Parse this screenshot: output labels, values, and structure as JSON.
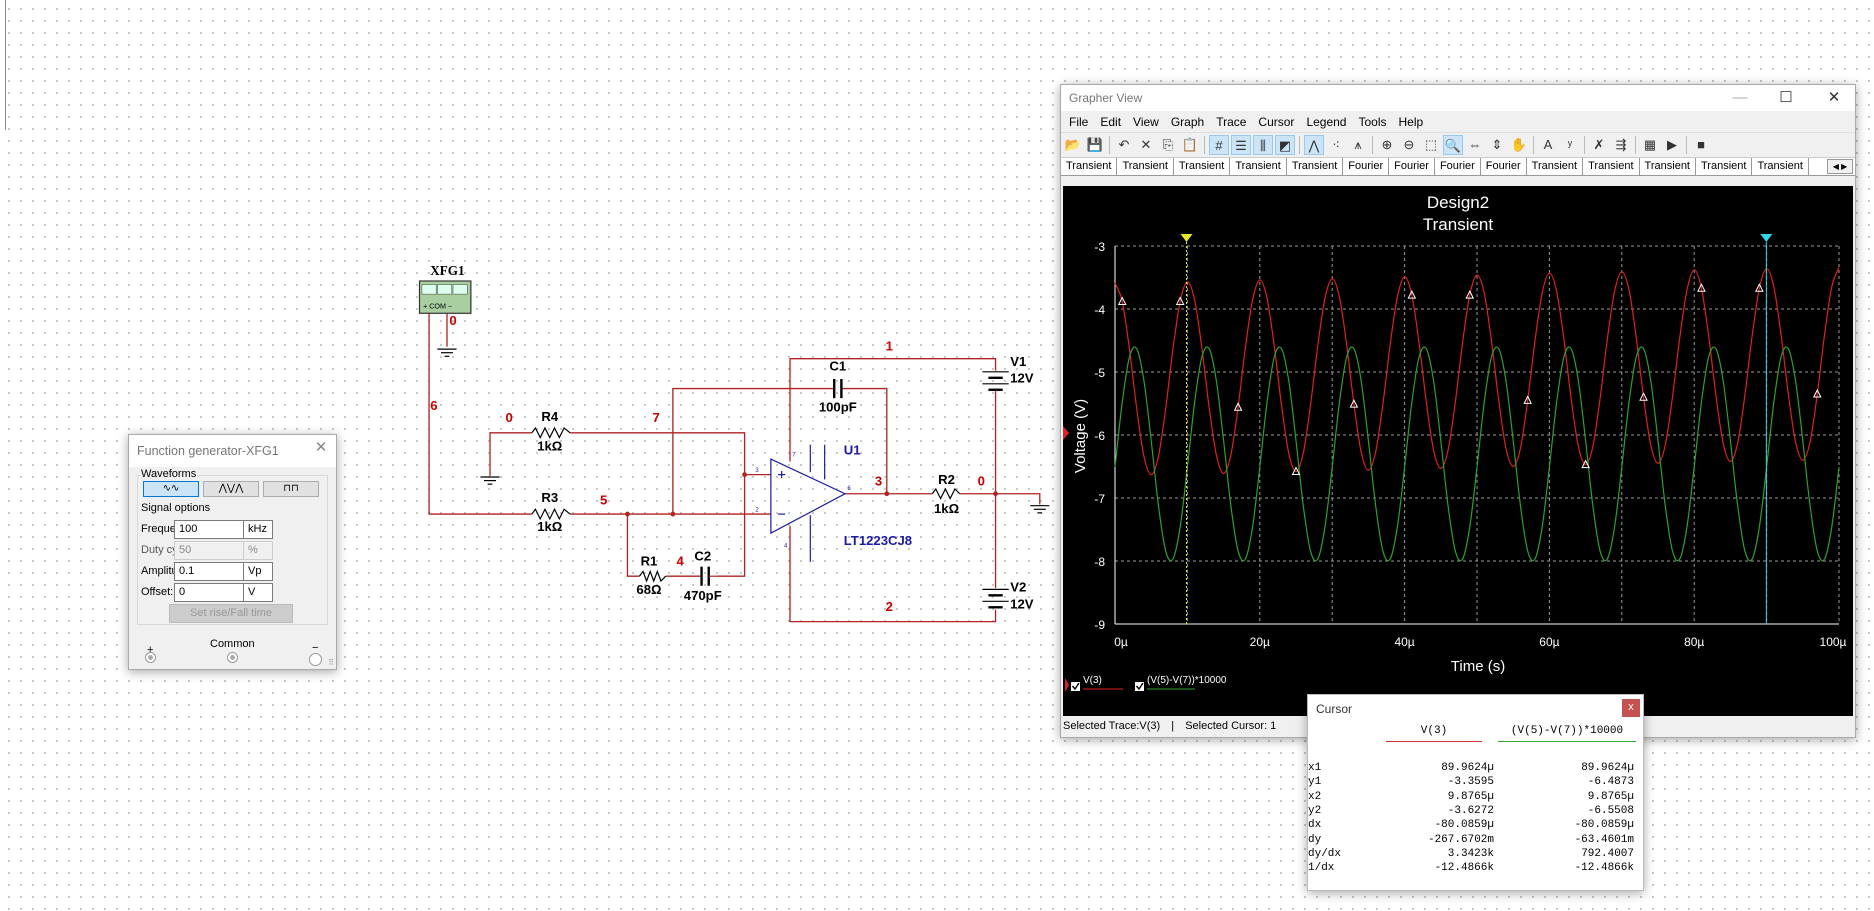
{
  "schematic": {
    "generator_ref": "XFG1",
    "generator_terminals": "+ COM −",
    "net_labels": {
      "n0a": "0",
      "n0b": "0",
      "n0c": "0",
      "n1": "1",
      "n2": "2",
      "n3": "3",
      "n4": "4",
      "n5": "5",
      "n6": "6",
      "n7": "7"
    },
    "components": {
      "R1": {
        "ref": "R1",
        "value": "68Ω"
      },
      "R2": {
        "ref": "R2",
        "value": "1kΩ"
      },
      "R3": {
        "ref": "R3",
        "value": "1kΩ"
      },
      "R4": {
        "ref": "R4",
        "value": "1kΩ"
      },
      "C1": {
        "ref": "C1",
        "value": "100pF"
      },
      "C2": {
        "ref": "C2",
        "value": "470pF"
      },
      "V1": {
        "ref": "V1",
        "value": "12V"
      },
      "V2": {
        "ref": "V2",
        "value": "12V"
      },
      "U1": {
        "ref": "U1",
        "part": "LT1223CJ8"
      }
    },
    "pin_numbers": {
      "plus": "3",
      "minus": "2",
      "out": "6",
      "top": "7",
      "bottom": "4"
    },
    "wire_color": "#b22222",
    "net_label_color": "#cc0000",
    "part_color": "#1a1aa6"
  },
  "function_generator": {
    "title": "Function generator-XFG1",
    "waveforms_label": "Waveforms",
    "waveforms": [
      "sine",
      "triangle",
      "square"
    ],
    "selected_waveform": "sine",
    "signal_options_label": "Signal options",
    "fields": [
      {
        "label": "Frequency:",
        "value": "100",
        "unit": "kHz",
        "enabled": true
      },
      {
        "label": "Duty cycle:",
        "value": "50",
        "unit": "%",
        "enabled": false
      },
      {
        "label": "Amplitude:",
        "value": "0.1",
        "unit": "Vp",
        "enabled": true
      },
      {
        "label": "Offset:",
        "value": "0",
        "unit": "V",
        "enabled": true
      }
    ],
    "rise_fall_button": "Set rise/Fall time",
    "terminals": {
      "plus": "+",
      "common": "Common",
      "minus": "−"
    }
  },
  "grapher": {
    "title": "Grapher View",
    "menu": [
      "File",
      "Edit",
      "View",
      "Graph",
      "Trace",
      "Cursor",
      "Legend",
      "Tools",
      "Help"
    ],
    "toolbar": [
      {
        "icon": "open-icon",
        "glyph": "📂"
      },
      {
        "icon": "save-icon",
        "glyph": "💾"
      },
      {
        "sep": true
      },
      {
        "icon": "undo-icon",
        "glyph": "↶"
      },
      {
        "icon": "cut-icon",
        "glyph": "✕"
      },
      {
        "icon": "copy-icon",
        "glyph": "⎘"
      },
      {
        "icon": "paste-icon",
        "glyph": "📋"
      },
      {
        "sep": true
      },
      {
        "icon": "grid-icon",
        "glyph": "#",
        "active": true
      },
      {
        "icon": "legend-icon",
        "glyph": "☰",
        "active": true
      },
      {
        "icon": "cursors-icon",
        "glyph": "⫼",
        "active": true
      },
      {
        "icon": "black-background-icon",
        "glyph": "◩",
        "active": true
      },
      {
        "sep": true
      },
      {
        "icon": "lines-icon",
        "glyph": "⋀",
        "active": true
      },
      {
        "icon": "points-icon",
        "glyph": "⁖"
      },
      {
        "icon": "lines-points-icon",
        "glyph": "⩚"
      },
      {
        "sep": true
      },
      {
        "icon": "zoom-in-icon",
        "glyph": "⊕"
      },
      {
        "icon": "zoom-out-icon",
        "glyph": "⊖"
      },
      {
        "icon": "zoom-area-icon",
        "glyph": "⬚"
      },
      {
        "icon": "zoom-full-icon",
        "glyph": "🔍",
        "active": true
      },
      {
        "icon": "zoom-x-icon",
        "glyph": "⇔"
      },
      {
        "icon": "zoom-y-icon",
        "glyph": "⇕"
      },
      {
        "icon": "pan-icon",
        "glyph": "✋"
      },
      {
        "sep": true
      },
      {
        "icon": "text-icon",
        "glyph": "A"
      },
      {
        "icon": "trace-properties-icon",
        "glyph": "ʸ"
      },
      {
        "sep": true
      },
      {
        "icon": "overlay-traces-icon",
        "glyph": "✗"
      },
      {
        "icon": "export-icon",
        "glyph": "⇶"
      },
      {
        "sep": true
      },
      {
        "icon": "export-excel-icon",
        "glyph": "▦"
      },
      {
        "icon": "export-lvm-icon",
        "glyph": "▶"
      },
      {
        "sep": true
      },
      {
        "icon": "stop-icon",
        "glyph": "■"
      }
    ],
    "tabs": [
      "Transient",
      "Transient",
      "Transient",
      "Transient",
      "Transient",
      "Fourier",
      "Fourier",
      "Fourier",
      "Fourier",
      "Transient",
      "Transient",
      "Transient",
      "Transient",
      "Transient"
    ],
    "status": {
      "selected_trace": "Selected Trace:V(3)",
      "separator": "|",
      "selected_cursor": "Selected Cursor: 1"
    }
  },
  "chart_data": {
    "type": "line",
    "title": "Design2",
    "subtitle": "Transient",
    "xlabel": "Time (s)",
    "ylabel": "Voltage (V)",
    "xlim": [
      0,
      100
    ],
    "ylim": [
      -9,
      -3
    ],
    "x_unit_note": "µs",
    "x_ticks": [
      0,
      20,
      40,
      60,
      80,
      100
    ],
    "x_tick_labels": [
      "0µ",
      "20µ",
      "40µ",
      "60µ",
      "80µ",
      "100µ"
    ],
    "y_ticks": [
      -3,
      -4,
      -5,
      -6,
      -7,
      -8,
      -9
    ],
    "y_tick_labels": [
      "-3",
      "-4",
      "-5",
      "-6",
      "-7",
      "-8",
      "-9"
    ],
    "grid": true,
    "background": "#000000",
    "legend_position": "bottom-left",
    "x": [
      0,
      1,
      2,
      3,
      4,
      5,
      6,
      7,
      8,
      9,
      10,
      11,
      12,
      13,
      14,
      15,
      16,
      17,
      18,
      19,
      20,
      21,
      22,
      23,
      24,
      25,
      26,
      27,
      28,
      29,
      30,
      31,
      32,
      33,
      34,
      35,
      36,
      37,
      38,
      39,
      40,
      41,
      42,
      43,
      44,
      45,
      46,
      47,
      48,
      49,
      50,
      51,
      52,
      53,
      54,
      55,
      56,
      57,
      58,
      59,
      60,
      61,
      62,
      63,
      64,
      65,
      66,
      67,
      68,
      69,
      70,
      71,
      72,
      73,
      74,
      75,
      76,
      77,
      78,
      79,
      80,
      81,
      82,
      83,
      84,
      85,
      86,
      87,
      88,
      89,
      90,
      91,
      92,
      93,
      94,
      95,
      96,
      97,
      98,
      99,
      100
    ],
    "series": [
      {
        "name": "V(3)",
        "color": "#e02020",
        "values": [
          -3.59,
          -3.88,
          -4.64,
          -5.58,
          -6.34,
          -6.63,
          -6.34,
          -5.58,
          -4.64,
          -3.88,
          -3.57,
          -3.86,
          -4.62,
          -5.56,
          -6.32,
          -6.61,
          -6.32,
          -5.56,
          -4.62,
          -3.86,
          -3.54,
          -3.83,
          -4.59,
          -5.53,
          -6.29,
          -6.58,
          -6.29,
          -5.53,
          -4.59,
          -3.83,
          -3.52,
          -3.81,
          -4.57,
          -5.51,
          -6.27,
          -6.56,
          -6.27,
          -5.51,
          -4.57,
          -3.81,
          -3.49,
          -3.78,
          -4.54,
          -5.48,
          -6.24,
          -6.53,
          -6.24,
          -5.48,
          -4.54,
          -3.78,
          -3.46,
          -3.75,
          -4.51,
          -5.45,
          -6.21,
          -6.5,
          -6.21,
          -5.45,
          -4.51,
          -3.75,
          -3.43,
          -3.72,
          -4.48,
          -5.42,
          -6.18,
          -6.47,
          -6.18,
          -5.42,
          -4.48,
          -3.72,
          -3.41,
          -3.7,
          -4.46,
          -5.4,
          -6.16,
          -6.45,
          -6.16,
          -5.4,
          -4.46,
          -3.7,
          -3.38,
          -3.67,
          -4.43,
          -5.37,
          -6.13,
          -6.42,
          -6.13,
          -5.37,
          -4.43,
          -3.67,
          -3.36,
          -3.65,
          -4.41,
          -5.35,
          -6.11,
          -6.4,
          -6.11,
          -5.35,
          -4.41,
          -3.65,
          -3.34
        ]
      },
      {
        "name": "(V(5)-V(7))*10000",
        "color": "#2ea02e",
        "values": [
          -6.51,
          -5.48,
          -4.76,
          -4.63,
          -5.14,
          -6.09,
          -7.12,
          -7.84,
          -7.97,
          -7.46,
          -6.51,
          -5.48,
          -4.76,
          -4.63,
          -5.14,
          -6.09,
          -7.12,
          -7.84,
          -7.97,
          -7.46,
          -6.51,
          -5.48,
          -4.76,
          -4.63,
          -5.14,
          -6.09,
          -7.12,
          -7.84,
          -7.97,
          -7.46,
          -6.51,
          -5.48,
          -4.76,
          -4.63,
          -5.14,
          -6.09,
          -7.12,
          -7.84,
          -7.97,
          -7.46,
          -6.51,
          -5.48,
          -4.76,
          -4.63,
          -5.14,
          -6.09,
          -7.12,
          -7.84,
          -7.97,
          -7.46,
          -6.51,
          -5.48,
          -4.76,
          -4.63,
          -5.14,
          -6.09,
          -7.12,
          -7.84,
          -7.97,
          -7.46,
          -6.51,
          -5.48,
          -4.76,
          -4.63,
          -5.14,
          -6.09,
          -7.12,
          -7.84,
          -7.97,
          -7.46,
          -6.51,
          -5.48,
          -4.76,
          -4.63,
          -5.14,
          -6.09,
          -7.12,
          -7.84,
          -7.97,
          -7.46,
          -6.51,
          -5.48,
          -4.76,
          -4.63,
          -5.14,
          -6.09,
          -7.12,
          -7.84,
          -7.97,
          -7.46,
          -6.51,
          -5.48,
          -4.76,
          -4.63,
          -5.14,
          -6.09,
          -7.12,
          -7.84,
          -7.97,
          -7.46,
          -6.51
        ]
      }
    ],
    "cursors": [
      {
        "id": "1",
        "x": 89.9624,
        "color": "#33d6e6"
      },
      {
        "id": "2",
        "x": 9.8765,
        "color": "#e6e633"
      }
    ]
  },
  "cursor_dialog": {
    "title": "Cursor",
    "close": "x",
    "columns": [
      "V(3)",
      "(V(5)-V(7))*10000"
    ],
    "rows": [
      {
        "label": "x1",
        "v": [
          "89.9624µ",
          "89.9624µ"
        ]
      },
      {
        "label": "y1",
        "v": [
          "-3.3595",
          "-6.4873"
        ]
      },
      {
        "label": "x2",
        "v": [
          "9.8765µ",
          "9.8765µ"
        ]
      },
      {
        "label": "y2",
        "v": [
          "-3.6272",
          "-6.5508"
        ]
      },
      {
        "label": "dx",
        "v": [
          "-80.0859µ",
          "-80.0859µ"
        ]
      },
      {
        "label": "dy",
        "v": [
          "-267.6702m",
          "-63.4601m"
        ]
      },
      {
        "label": "dy/dx",
        "v": [
          "3.3423k",
          "792.4007"
        ]
      },
      {
        "label": "1/dx",
        "v": [
          "-12.4866k",
          "-12.4866k"
        ]
      }
    ]
  }
}
